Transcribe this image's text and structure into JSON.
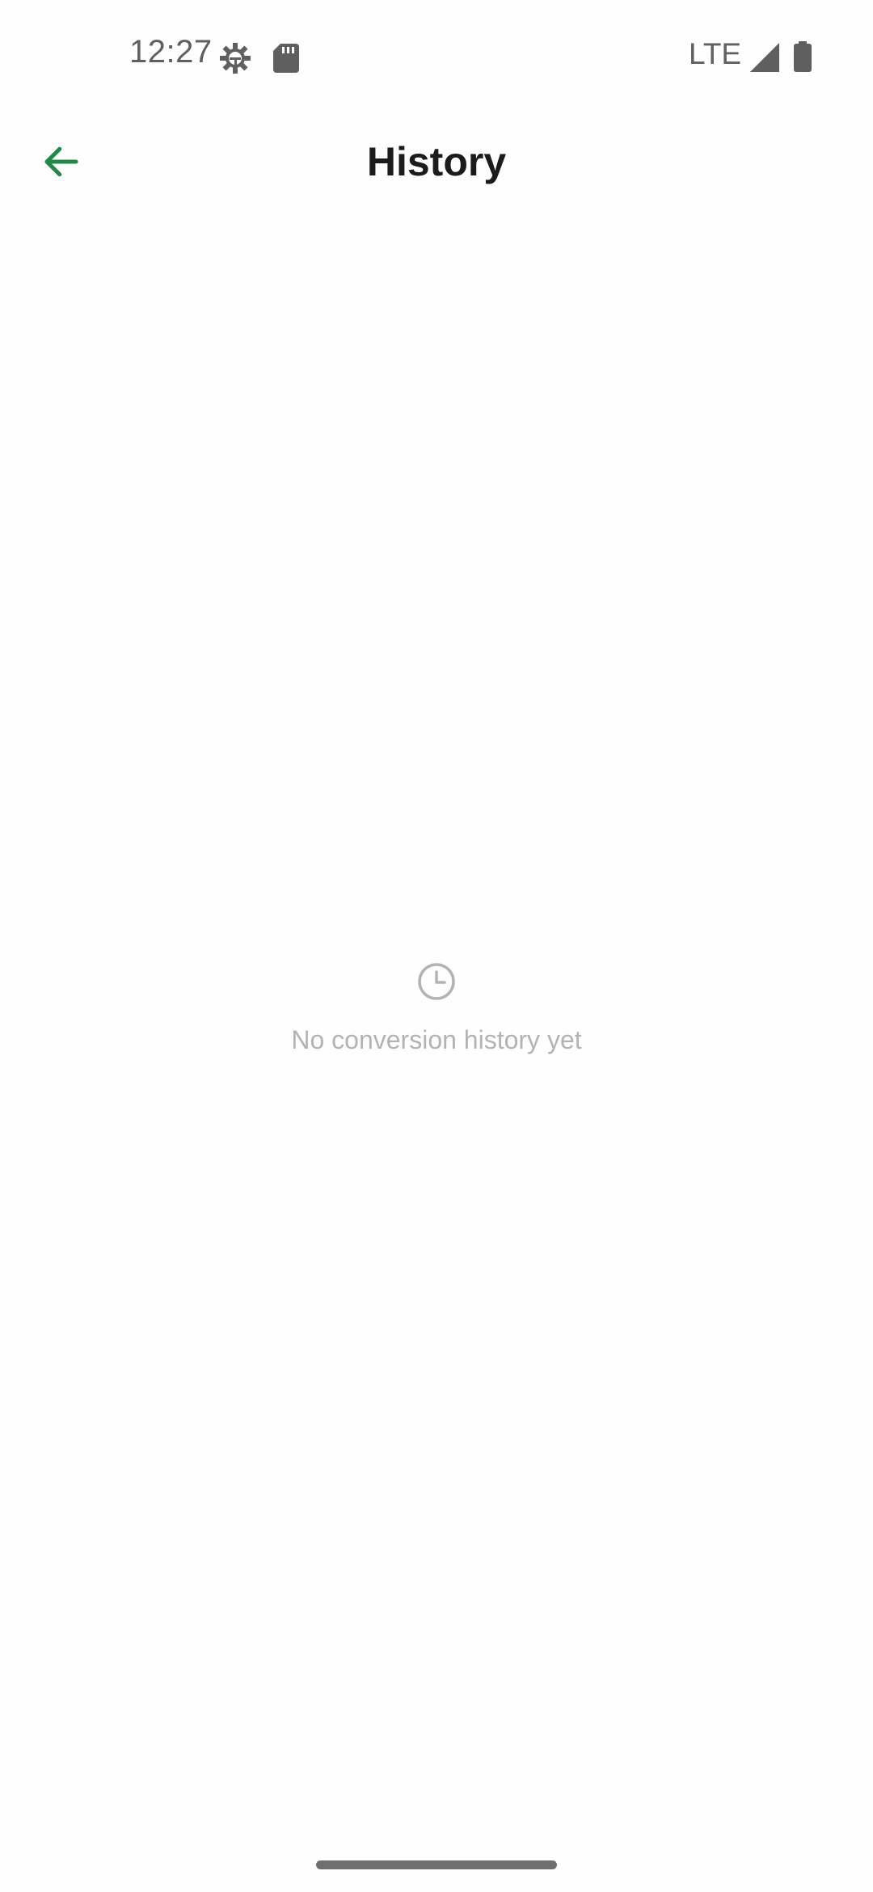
{
  "status_bar": {
    "time": "12:27",
    "network": "LTE",
    "icons": [
      "gear-icon",
      "sd-card-icon",
      "signal-icon",
      "battery-icon"
    ]
  },
  "app_bar": {
    "title": "History",
    "back_icon": "arrow-left-icon",
    "accent_color": "#1e8a45"
  },
  "empty_state": {
    "icon": "clock-icon",
    "message": "No conversion history yet"
  },
  "colors": {
    "background": "#fefefe",
    "title": "#1b1b1b",
    "muted": "#b3b3b3",
    "status": "#5f5f5f"
  }
}
